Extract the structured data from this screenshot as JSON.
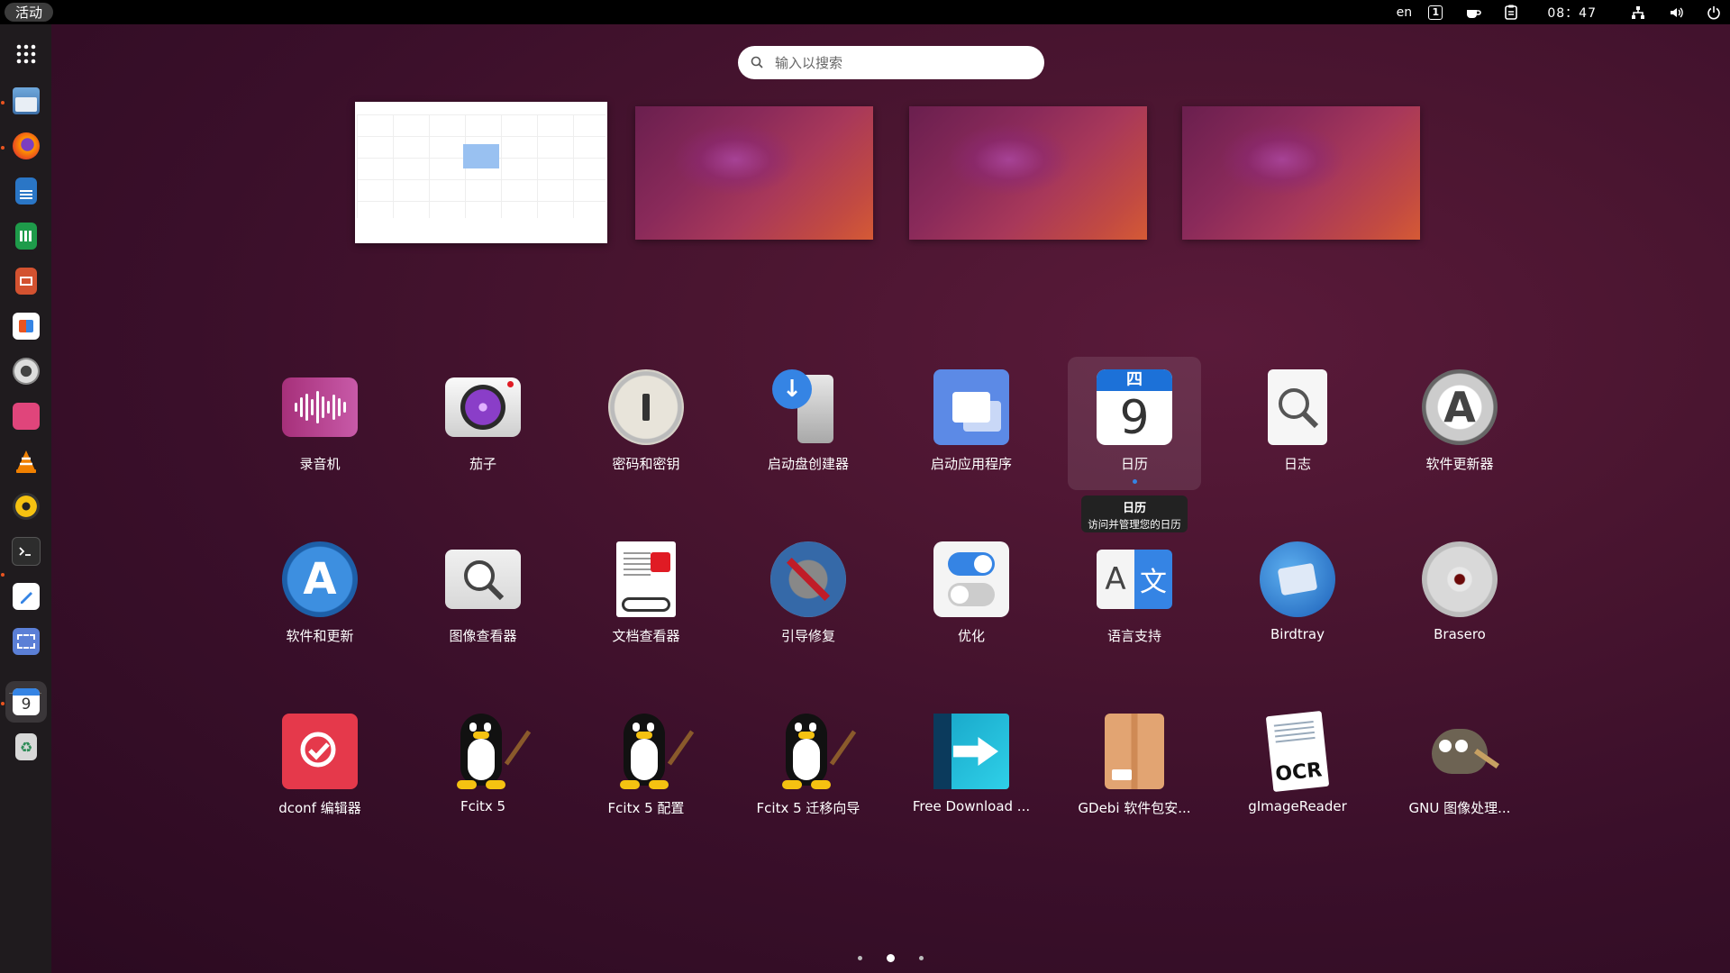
{
  "topbar": {
    "activities": "活动",
    "lang": "en",
    "keyboard_box": "1",
    "clock": "08：47",
    "icons": [
      "keyboard-layout-icon",
      "coffee-icon",
      "clipboard-icon",
      "network-icon",
      "volume-icon",
      "power-icon"
    ]
  },
  "search": {
    "placeholder": "输入以搜索"
  },
  "apps": [
    {
      "label": "录音机",
      "icon": "sound-recorder-icon"
    },
    {
      "label": "茄子",
      "icon": "cheese-camera-icon"
    },
    {
      "label": "密码和密钥",
      "icon": "passwords-keys-icon"
    },
    {
      "label": "启动盘创建器",
      "icon": "startup-disk-creator-icon"
    },
    {
      "label": "启动应用程序",
      "icon": "startup-applications-icon"
    },
    {
      "label": "日历",
      "icon": "calendar-icon",
      "cal_weekday": "四",
      "cal_day": "9"
    },
    {
      "label": "日志",
      "icon": "logs-icon"
    },
    {
      "label": "软件更新器",
      "icon": "software-updater-icon"
    },
    {
      "label": "软件和更新",
      "icon": "software-updates-icon"
    },
    {
      "label": "图像查看器",
      "icon": "image-viewer-icon"
    },
    {
      "label": "文档查看器",
      "icon": "document-viewer-icon"
    },
    {
      "label": "引导修复",
      "icon": "boot-repair-icon"
    },
    {
      "label": "优化",
      "icon": "tweaks-icon"
    },
    {
      "label": "语言支持",
      "icon": "language-support-icon",
      "glyph_a": "A",
      "glyph_b": "文"
    },
    {
      "label": "Birdtray",
      "icon": "birdtray-icon"
    },
    {
      "label": "Brasero",
      "icon": "brasero-icon"
    },
    {
      "label": "dconf 编辑器",
      "icon": "dconf-editor-icon"
    },
    {
      "label": "Fcitx 5",
      "icon": "fcitx-icon"
    },
    {
      "label": "Fcitx 5 配置",
      "icon": "fcitx-config-icon"
    },
    {
      "label": "Fcitx 5 迁移向导",
      "icon": "fcitx-migrator-icon"
    },
    {
      "label": "Free Download ...",
      "icon": "free-download-manager-icon"
    },
    {
      "label": "GDebi 软件包安...",
      "icon": "gdebi-icon"
    },
    {
      "label": "gImageReader",
      "icon": "gimagereader-icon",
      "badge": "OCR"
    },
    {
      "label": "GNU 图像处理...",
      "icon": "gimp-icon"
    }
  ],
  "tooltip": {
    "title": "日历",
    "description": "访问并管理您的日历"
  },
  "dock": {
    "items": [
      "app-grid-icon",
      "files-icon",
      "firefox-icon",
      "writer-icon",
      "calc-icon",
      "impress-icon",
      "software-center-icon",
      "settings-icon",
      "app-installer-icon",
      "vlc-icon",
      "rhythmbox-icon",
      "terminal-icon",
      "text-editor-icon",
      "screenshot-icon",
      "calendar-icon",
      "trash-icon"
    ],
    "calendar_day": "9"
  },
  "pager": {
    "pages": 3,
    "current": 2
  },
  "colors": {
    "accent": "#e95420",
    "blue": "#3584e4"
  }
}
